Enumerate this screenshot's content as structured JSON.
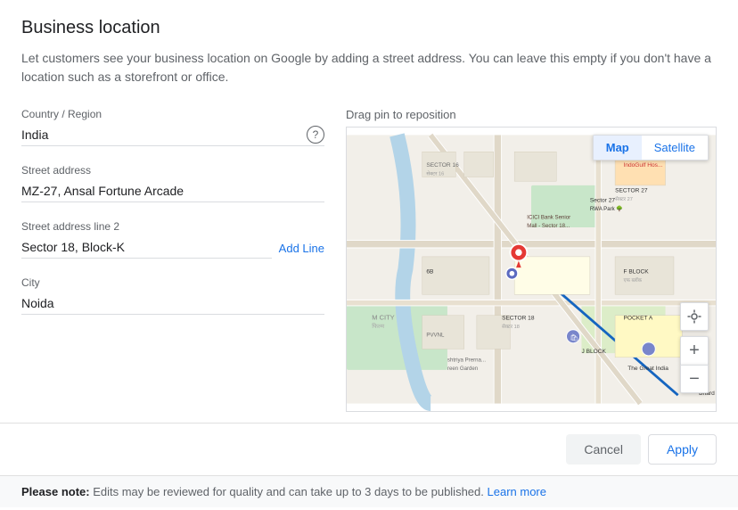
{
  "page": {
    "title": "Business location",
    "description": "Let customers see your business location on Google by adding a street address. You can leave this empty if you don't have a location such as a storefront or office."
  },
  "map": {
    "drag_label": "Drag pin to reposition",
    "toggle": {
      "map_label": "Map",
      "satellite_label": "Satellite",
      "active": "Map"
    }
  },
  "form": {
    "country_label": "Country / Region",
    "country_value": "India",
    "country_help_icon": "question-mark",
    "street_label": "Street address",
    "street_value": "MZ-27, Ansal Fortune Arcade",
    "street2_label": "Street address line 2",
    "street2_value": "Sector 18, Block-K",
    "add_line_label": "Add Line",
    "city_label": "City",
    "city_value": "Noida"
  },
  "footer": {
    "cancel_label": "Cancel",
    "apply_label": "Apply"
  },
  "note": {
    "prefix": "Please note:",
    "text": " Edits may be reviewed for quality and can take up to 3 days to be published. ",
    "learn_more": "Learn more"
  }
}
